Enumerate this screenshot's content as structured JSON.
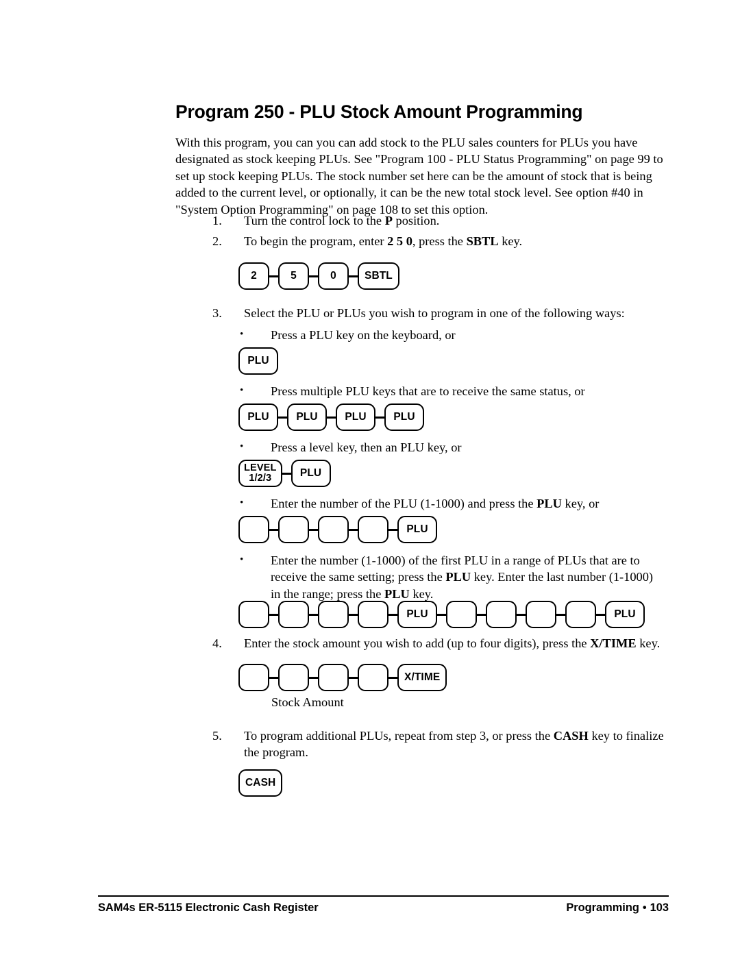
{
  "document": {
    "title": "Program 250 - PLU Stock Amount Programming",
    "intro": "With this program, you can you can add stock to the PLU sales counters for PLUs you have designated as stock keeping PLUs.  See \"Program 100 - PLU Status Programming\" on page 99 to set up stock keeping PLUs.  The stock number set here can be the amount of stock that is being added to the current level, or optionally, it can be the new total stock level.  See option #40 in \"System Option Programming\" on page 108 to set this option."
  },
  "steps": {
    "one": {
      "number": "1.",
      "text_before": "Turn the control lock to the ",
      "bold": "P",
      "text_after": " position."
    },
    "two": {
      "number": "2.",
      "text_before": "To begin the program, enter ",
      "bold1": "2 5 0",
      "text_mid": ", press the ",
      "bold2": "SBTL",
      "text_after": " key."
    },
    "three": {
      "number": "3.",
      "text": "Select the PLU or PLUs you wish to program in one of the following ways:"
    },
    "four": {
      "number": "4.",
      "text_before": "Enter the stock amount you wish to add (up to four digits), press the ",
      "bold": "X/TIME",
      "text_after": " key."
    },
    "five": {
      "number": "5.",
      "text_before": "To program additional PLUs, repeat from step 3, or press the ",
      "bold": "CASH",
      "text_after": " key to finalize the program."
    }
  },
  "bullets": {
    "marker": "•",
    "b1": {
      "text": "Press a PLU key on the keyboard, or"
    },
    "b2": {
      "text": "Press multiple PLU keys that are to receive the same status, or"
    },
    "b3": {
      "text": "Press a level key, then an PLU key, or"
    },
    "b4": {
      "text_before": "Enter the number of the PLU (1-1000) and press the ",
      "bold": "PLU",
      "text_after": " key, or"
    },
    "b5": {
      "text_before": "Enter the number (1-1000) of the first PLU in a range of PLUs that are to receive the same setting; press the ",
      "bold1": "PLU",
      "text_mid": " key.  Enter the last number (1-1000) in the range; press the ",
      "bold2": "PLU",
      "text_after": " key."
    }
  },
  "keys": {
    "seq_250_sbtl": [
      "2",
      "5",
      "0",
      "SBTL"
    ],
    "single_plu": [
      "PLU"
    ],
    "multi_plu": [
      "PLU",
      "PLU",
      "PLU",
      "PLU"
    ],
    "level_plu": {
      "level_line1": "LEVEL",
      "level_line2": "1/2/3",
      "plu": "PLU"
    },
    "plu_number": [
      "",
      "",
      "",
      "",
      "PLU"
    ],
    "plu_range": [
      "",
      "",
      "",
      "",
      "PLU",
      "",
      "",
      "",
      "",
      "PLU"
    ],
    "stock_amount": [
      "",
      "",
      "",
      "",
      "X/TIME"
    ],
    "cash": [
      "CASH"
    ]
  },
  "captions": {
    "stock_amount": "Stock Amount"
  },
  "footer": {
    "left": "SAM4s ER-5115 Electronic Cash Register",
    "section": "Programming",
    "separator": "•",
    "page": "103"
  }
}
